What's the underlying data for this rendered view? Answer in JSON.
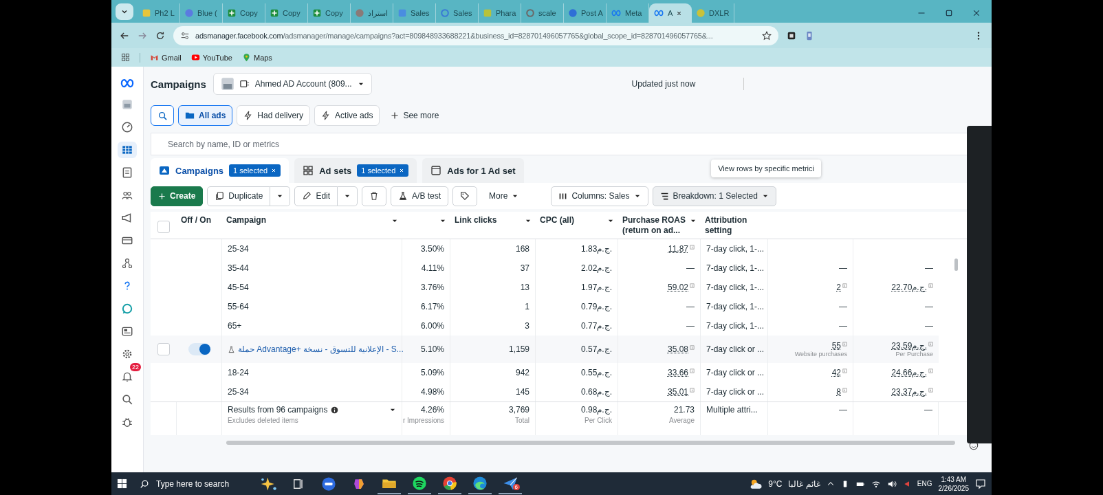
{
  "browser": {
    "tabs": [
      {
        "label": "Ph2 L",
        "selected": false,
        "kind": "square",
        "color": "#e8c53a"
      },
      {
        "label": "Blue (",
        "selected": false,
        "kind": "circle",
        "color": "#5b7be0"
      },
      {
        "label": "Copy",
        "selected": false,
        "kind": "sheet",
        "color": "#1e8e3e"
      },
      {
        "label": "Copy",
        "selected": false,
        "kind": "sheet",
        "color": "#1e8e3e"
      },
      {
        "label": "Copy",
        "selected": false,
        "kind": "sheet",
        "color": "#1e8e3e"
      },
      {
        "label": "استراد",
        "selected": false,
        "kind": "circle",
        "color": "#8a7a78"
      },
      {
        "label": "Sales",
        "selected": false,
        "kind": "square",
        "color": "#4a8de0"
      },
      {
        "label": "Sales",
        "selected": false,
        "kind": "ring",
        "color": "#3a7bd5"
      },
      {
        "label": "Phara",
        "selected": false,
        "kind": "square",
        "color": "#b8c23a"
      },
      {
        "label": "scale",
        "selected": false,
        "kind": "ring",
        "color": "#6a6a6a"
      },
      {
        "label": "Post A",
        "selected": false,
        "kind": "circle",
        "color": "#2f6fd6"
      },
      {
        "label": "Meta",
        "selected": false,
        "kind": "meta",
        "color": "#1877f2"
      },
      {
        "label": "A",
        "selected": true,
        "kind": "meta",
        "color": "#1877f2"
      },
      {
        "label": "DXLR",
        "selected": false,
        "kind": "circle",
        "color": "#c9c23a"
      }
    ],
    "url_host": "adsmanager.facebook.com",
    "url_path": "/adsmanager/manage/campaigns?act=809848933688221&business_id=828701496057765&global_scope_id=828701496057765&...",
    "bookmarks": [
      {
        "label": "Gmail",
        "kind": "mail"
      },
      {
        "label": "YouTube",
        "kind": "video"
      },
      {
        "label": "Maps",
        "kind": "pin"
      }
    ]
  },
  "app": {
    "title": "Campaigns",
    "account": "Ahmed AD Account (809...",
    "status": "Updated just now",
    "sidebar": [
      {
        "kind": "avatar",
        "selected": false
      },
      {
        "kind": "gauge",
        "selected": false
      },
      {
        "kind": "table",
        "selected": true
      },
      {
        "kind": "doc",
        "selected": false
      },
      {
        "kind": "people",
        "selected": false
      },
      {
        "kind": "megaphone",
        "selected": false
      },
      {
        "kind": "card",
        "selected": false
      },
      {
        "kind": "network",
        "selected": false
      },
      {
        "kind": "help",
        "selected": false
      },
      {
        "kind": "chat",
        "selected": false
      },
      {
        "kind": "news",
        "selected": false
      },
      {
        "kind": "gear",
        "selected": false
      },
      {
        "kind": "bell",
        "selected": false,
        "badge": "22"
      },
      {
        "kind": "search",
        "selected": false
      },
      {
        "kind": "bug",
        "selected": false
      }
    ],
    "filters": [
      {
        "label": "All ads",
        "selected": true,
        "kind": "folder"
      },
      {
        "label": "Had delivery",
        "selected": false,
        "kind": "bolt"
      },
      {
        "label": "Active ads",
        "selected": false,
        "kind": "bolt"
      },
      {
        "label": "See more",
        "selected": false,
        "kind": "plus"
      }
    ],
    "search": {
      "placeholder": "Search by name, ID or metrics"
    },
    "levels": [
      {
        "label": "Campaigns",
        "badge": "1 selected",
        "selected": true,
        "kind": "flag"
      },
      {
        "label": "Ad sets",
        "badge": "1 selected",
        "selected": false,
        "kind": "grid"
      },
      {
        "label": "Ads for 1 Ad set",
        "selected": false,
        "kind": "window"
      }
    ],
    "toolbar": {
      "create": "Create",
      "duplicate": "Duplicate",
      "edit": "Edit",
      "ab_test": "A/B test",
      "more": "More",
      "columns": "Columns: Sales",
      "breakdown": "Breakdown: 1 Selected",
      "tooltip": "View rows by specific metrici"
    },
    "table": {
      "select_all": {
        "checked": false
      },
      "toggle_header": "Off / On",
      "name_header": {
        "label": "Campaign",
        "sort": true
      },
      "columns": [
        {
          "sort": true
        },
        {
          "label": "Link clicks",
          "sort": true
        },
        {
          "label": "CPC (all)",
          "sort": true
        },
        {
          "label": "Purchase ROAS (return on ad...",
          "sort": true
        },
        {
          "label": "Attribution setting",
          "sort": false
        },
        {
          "sort": false
        },
        {
          "sort": false
        }
      ],
      "rows": [
        {
          "kind": "breakdown",
          "name": "25-34",
          "cells": [
            "3.50%",
            "168",
            "1.83ج.م.",
            {
              "text": "11.87",
              "linked": true
            },
            "7-day click, 1-...",
            null,
            null
          ]
        },
        {
          "kind": "breakdown",
          "name": "35-44",
          "cells": [
            "4.11%",
            "37",
            "2.02ج.م.",
            "—",
            "7-day click, 1-...",
            "—",
            "—"
          ]
        },
        {
          "kind": "breakdown",
          "name": "45-54",
          "cells": [
            "3.76%",
            "13",
            "1.97ج.م.",
            {
              "text": "59.02",
              "linked": true
            },
            "7-day click, 1-...",
            {
              "text": "2",
              "linked": true
            },
            {
              "text": "22.70ج.م.",
              "linked": true
            }
          ]
        },
        {
          "kind": "breakdown",
          "name": "55-64",
          "cells": [
            "6.17%",
            "1",
            "0.79ج.م.",
            "—",
            "7-day click, 1-...",
            "—",
            "—"
          ]
        },
        {
          "kind": "breakdown",
          "name": "65+",
          "cells": [
            "6.00%",
            "3",
            "0.77ج.م.",
            "—",
            "7-day click, 1-...",
            "—",
            "—"
          ]
        },
        {
          "kind": "campaign",
          "name": "حملة Advantage+ الإعلانية للتسوق - نسخة - S...",
          "checked": false,
          "on": true,
          "cells": [
            "5.10%",
            "1,159",
            "0.57ج.م.",
            {
              "text": "35.08",
              "linked": true
            },
            "7-day click or ...",
            {
              "text": "55",
              "linked": true,
              "note": "Website purchases"
            },
            {
              "text": "23.59ج.م.",
              "linked": true,
              "note": "Per Purchase"
            }
          ]
        },
        {
          "kind": "breakdown",
          "name": "18-24",
          "cells": [
            "5.09%",
            "942",
            "0.55ج.م.",
            {
              "text": "33.66",
              "linked": true
            },
            "7-day click or ...",
            {
              "text": "42",
              "linked": true
            },
            {
              "text": "24.66ج.م.",
              "linked": true
            }
          ]
        },
        {
          "kind": "breakdown",
          "name": "25-34",
          "cells": [
            "4.98%",
            "145",
            "0.68ج.م.",
            {
              "text": "35.01",
              "linked": true
            },
            "7-day click or ...",
            {
              "text": "8",
              "linked": true
            },
            {
              "text": "23.37ج.م.",
              "linked": true
            }
          ]
        }
      ],
      "footer": {
        "label": "Results from 96 campaigns",
        "sub": "Excludes deleted items",
        "cells": [
          {
            "text": "4.26%",
            "note": "r Impressions"
          },
          {
            "text": "3,769",
            "note": "Total"
          },
          {
            "text": "0.98ج.م.",
            "note": "Per Click"
          },
          {
            "text": "21.73",
            "note": "Average"
          },
          "Multiple attri...",
          "—",
          "—"
        ]
      }
    }
  },
  "taskbar": {
    "search": "Type here to search",
    "apps": [
      {
        "kind": "copilot",
        "open": false
      },
      {
        "kind": "taskview",
        "open": false
      },
      {
        "kind": "meet",
        "open": false
      },
      {
        "kind": "m365",
        "open": false
      },
      {
        "kind": "folder",
        "open": true
      },
      {
        "kind": "spotify",
        "open": true
      },
      {
        "kind": "chrome",
        "open": true
      },
      {
        "kind": "edge",
        "open": true
      },
      {
        "kind": "paper",
        "open": true,
        "badge": "6"
      }
    ],
    "temp": "9°C",
    "weather": "غائم غالبا",
    "lang": "ENG",
    "time": "1:43 AM",
    "date": "2/26/2025"
  }
}
